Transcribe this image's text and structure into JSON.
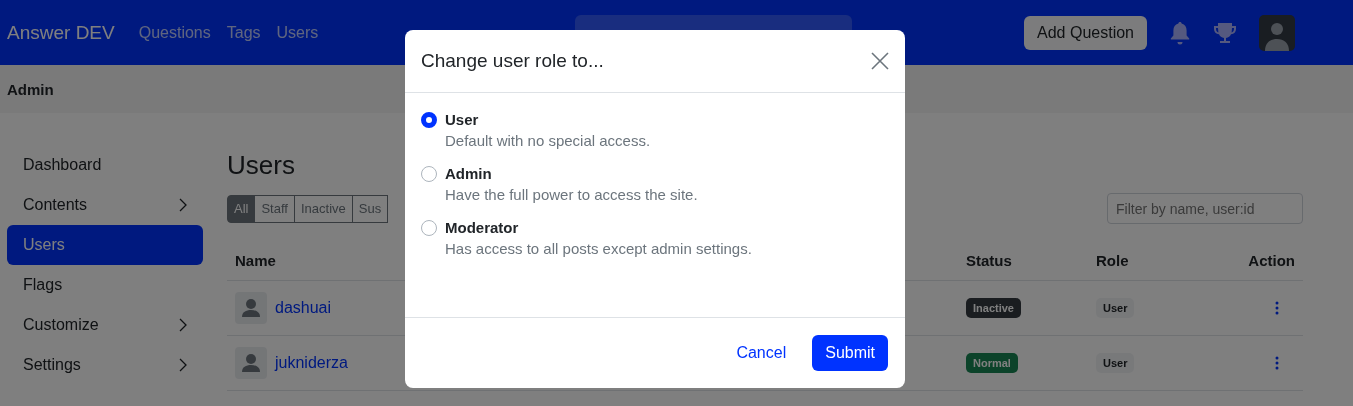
{
  "header": {
    "brand": "Answer DEV",
    "nav": [
      {
        "label": "Questions"
      },
      {
        "label": "Tags"
      },
      {
        "label": "Users"
      }
    ],
    "add_button": "Add Question"
  },
  "admin_bar": {
    "title": "Admin"
  },
  "sidebar": {
    "items": [
      {
        "label": "Dashboard",
        "selected": false,
        "has_submenu": false
      },
      {
        "label": "Contents",
        "selected": false,
        "has_submenu": true
      },
      {
        "label": "Users",
        "selected": true,
        "has_submenu": false
      },
      {
        "label": "Flags",
        "selected": false,
        "has_submenu": false
      },
      {
        "label": "Customize",
        "selected": false,
        "has_submenu": true
      },
      {
        "label": "Settings",
        "selected": false,
        "has_submenu": true
      }
    ]
  },
  "page_title": "Users",
  "filter_tabs": [
    {
      "label": "All",
      "selected": true
    },
    {
      "label": "Staff",
      "selected": false
    },
    {
      "label": "Inactive",
      "selected": false
    },
    {
      "label": "Sus",
      "selected": false
    }
  ],
  "filter_field": {
    "placeholder": "Filter by name, user:id"
  },
  "table": {
    "columns": [
      {
        "label": "Name"
      },
      {
        "label": "Status"
      },
      {
        "label": "Role"
      },
      {
        "label": "Action"
      }
    ],
    "rows": [
      {
        "name": "dashuai",
        "status": {
          "label": "Inactive",
          "kind": "inactive"
        },
        "role": "User"
      },
      {
        "name": "jukniderza",
        "status": {
          "label": "Normal",
          "kind": "normal"
        },
        "role": "User"
      }
    ]
  },
  "modal": {
    "title": "Change user role to...",
    "options": [
      {
        "label": "User",
        "description": "Default with no special access.",
        "selected": true
      },
      {
        "label": "Admin",
        "description": "Have the full power to access the site.",
        "selected": false
      },
      {
        "label": "Moderator",
        "description": "Has access to all posts except admin settings.",
        "selected": false
      }
    ],
    "cancel": "Cancel",
    "submit": "Submit"
  }
}
